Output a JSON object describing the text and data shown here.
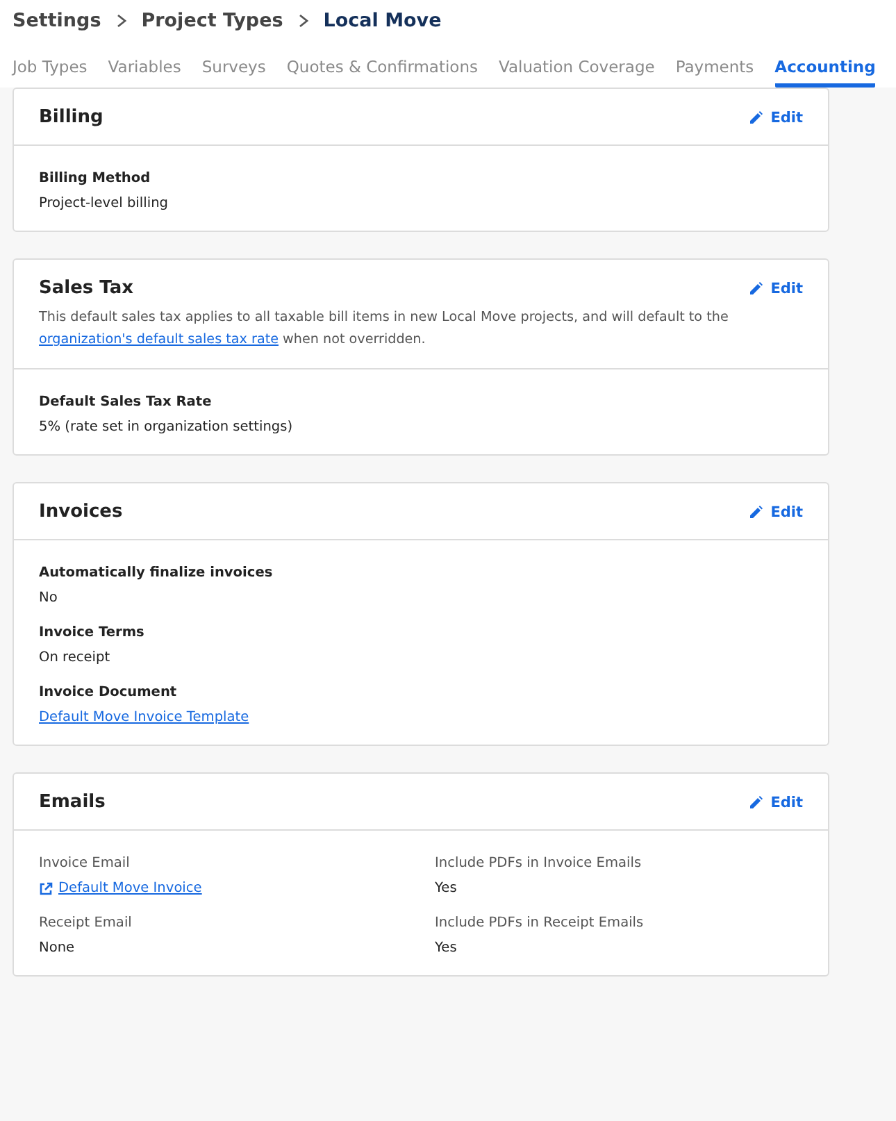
{
  "breadcrumb": [
    {
      "label": "Settings",
      "current": false
    },
    {
      "label": "Project Types",
      "current": false
    },
    {
      "label": "Local Move",
      "current": true
    }
  ],
  "tabs": [
    {
      "label": "Job Types",
      "selected": false
    },
    {
      "label": "Variables",
      "selected": false
    },
    {
      "label": "Surveys",
      "selected": false
    },
    {
      "label": "Quotes & Confirmations",
      "selected": false
    },
    {
      "label": "Valuation Coverage",
      "selected": false
    },
    {
      "label": "Payments",
      "selected": false
    },
    {
      "label": "Accounting",
      "selected": true
    }
  ],
  "sections": [
    {
      "title": "Billing",
      "edit": "Edit",
      "kind": "stack",
      "fields": [
        {
          "label": "Billing Method",
          "value": "Project-level billing",
          "kind": "text"
        }
      ]
    },
    {
      "title": "Sales Tax",
      "edit": "Edit",
      "kind": "stack",
      "description": [
        {
          "kind": "text",
          "text": "This default sales tax applies to all taxable bill items in new Local Move projects, and will default to the "
        },
        {
          "kind": "link",
          "text": "organization's default sales tax rate"
        },
        {
          "kind": "text",
          "text": " when not overridden."
        }
      ],
      "fields": [
        {
          "label": "Default Sales Tax Rate",
          "value": "5% (rate set in organization settings)",
          "kind": "text"
        }
      ]
    },
    {
      "title": "Invoices",
      "edit": "Edit",
      "kind": "stack",
      "fields": [
        {
          "label": "Automatically finalize invoices",
          "value": "No",
          "kind": "text"
        },
        {
          "label": "Invoice Terms",
          "value": "On receipt",
          "kind": "text"
        },
        {
          "label": "Invoice Document",
          "value": "Default Move Invoice Template",
          "kind": "link"
        }
      ]
    },
    {
      "title": "Emails",
      "edit": "Edit",
      "kind": "grid",
      "fields": [
        {
          "label": "Invoice Email",
          "value": "Default Move Invoice",
          "kind": "external"
        },
        {
          "label": "Include PDFs in Invoice Emails",
          "value": "Yes",
          "kind": "text"
        },
        {
          "label": "Receipt Email",
          "value": "None",
          "kind": "text"
        },
        {
          "label": "Include PDFs in Receipt Emails",
          "value": "Yes",
          "kind": "text"
        }
      ]
    }
  ]
}
